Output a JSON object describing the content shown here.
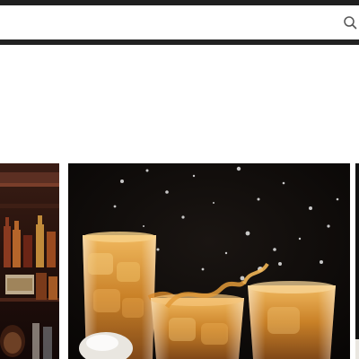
{
  "search": {
    "value": "",
    "placeholder": "",
    "icon": "search-icon"
  },
  "colors": {
    "bar": "#1f1f1f",
    "background": "#ffffff",
    "whiskey": "#d08a25",
    "dark_bg": "#0d0907"
  },
  "carousel": {
    "slides": [
      {
        "name": "bar-shelf-bottles-photo"
      },
      {
        "name": "whiskey-glasses-splash-photo"
      },
      {
        "name": "next-slide-photo"
      }
    ]
  }
}
